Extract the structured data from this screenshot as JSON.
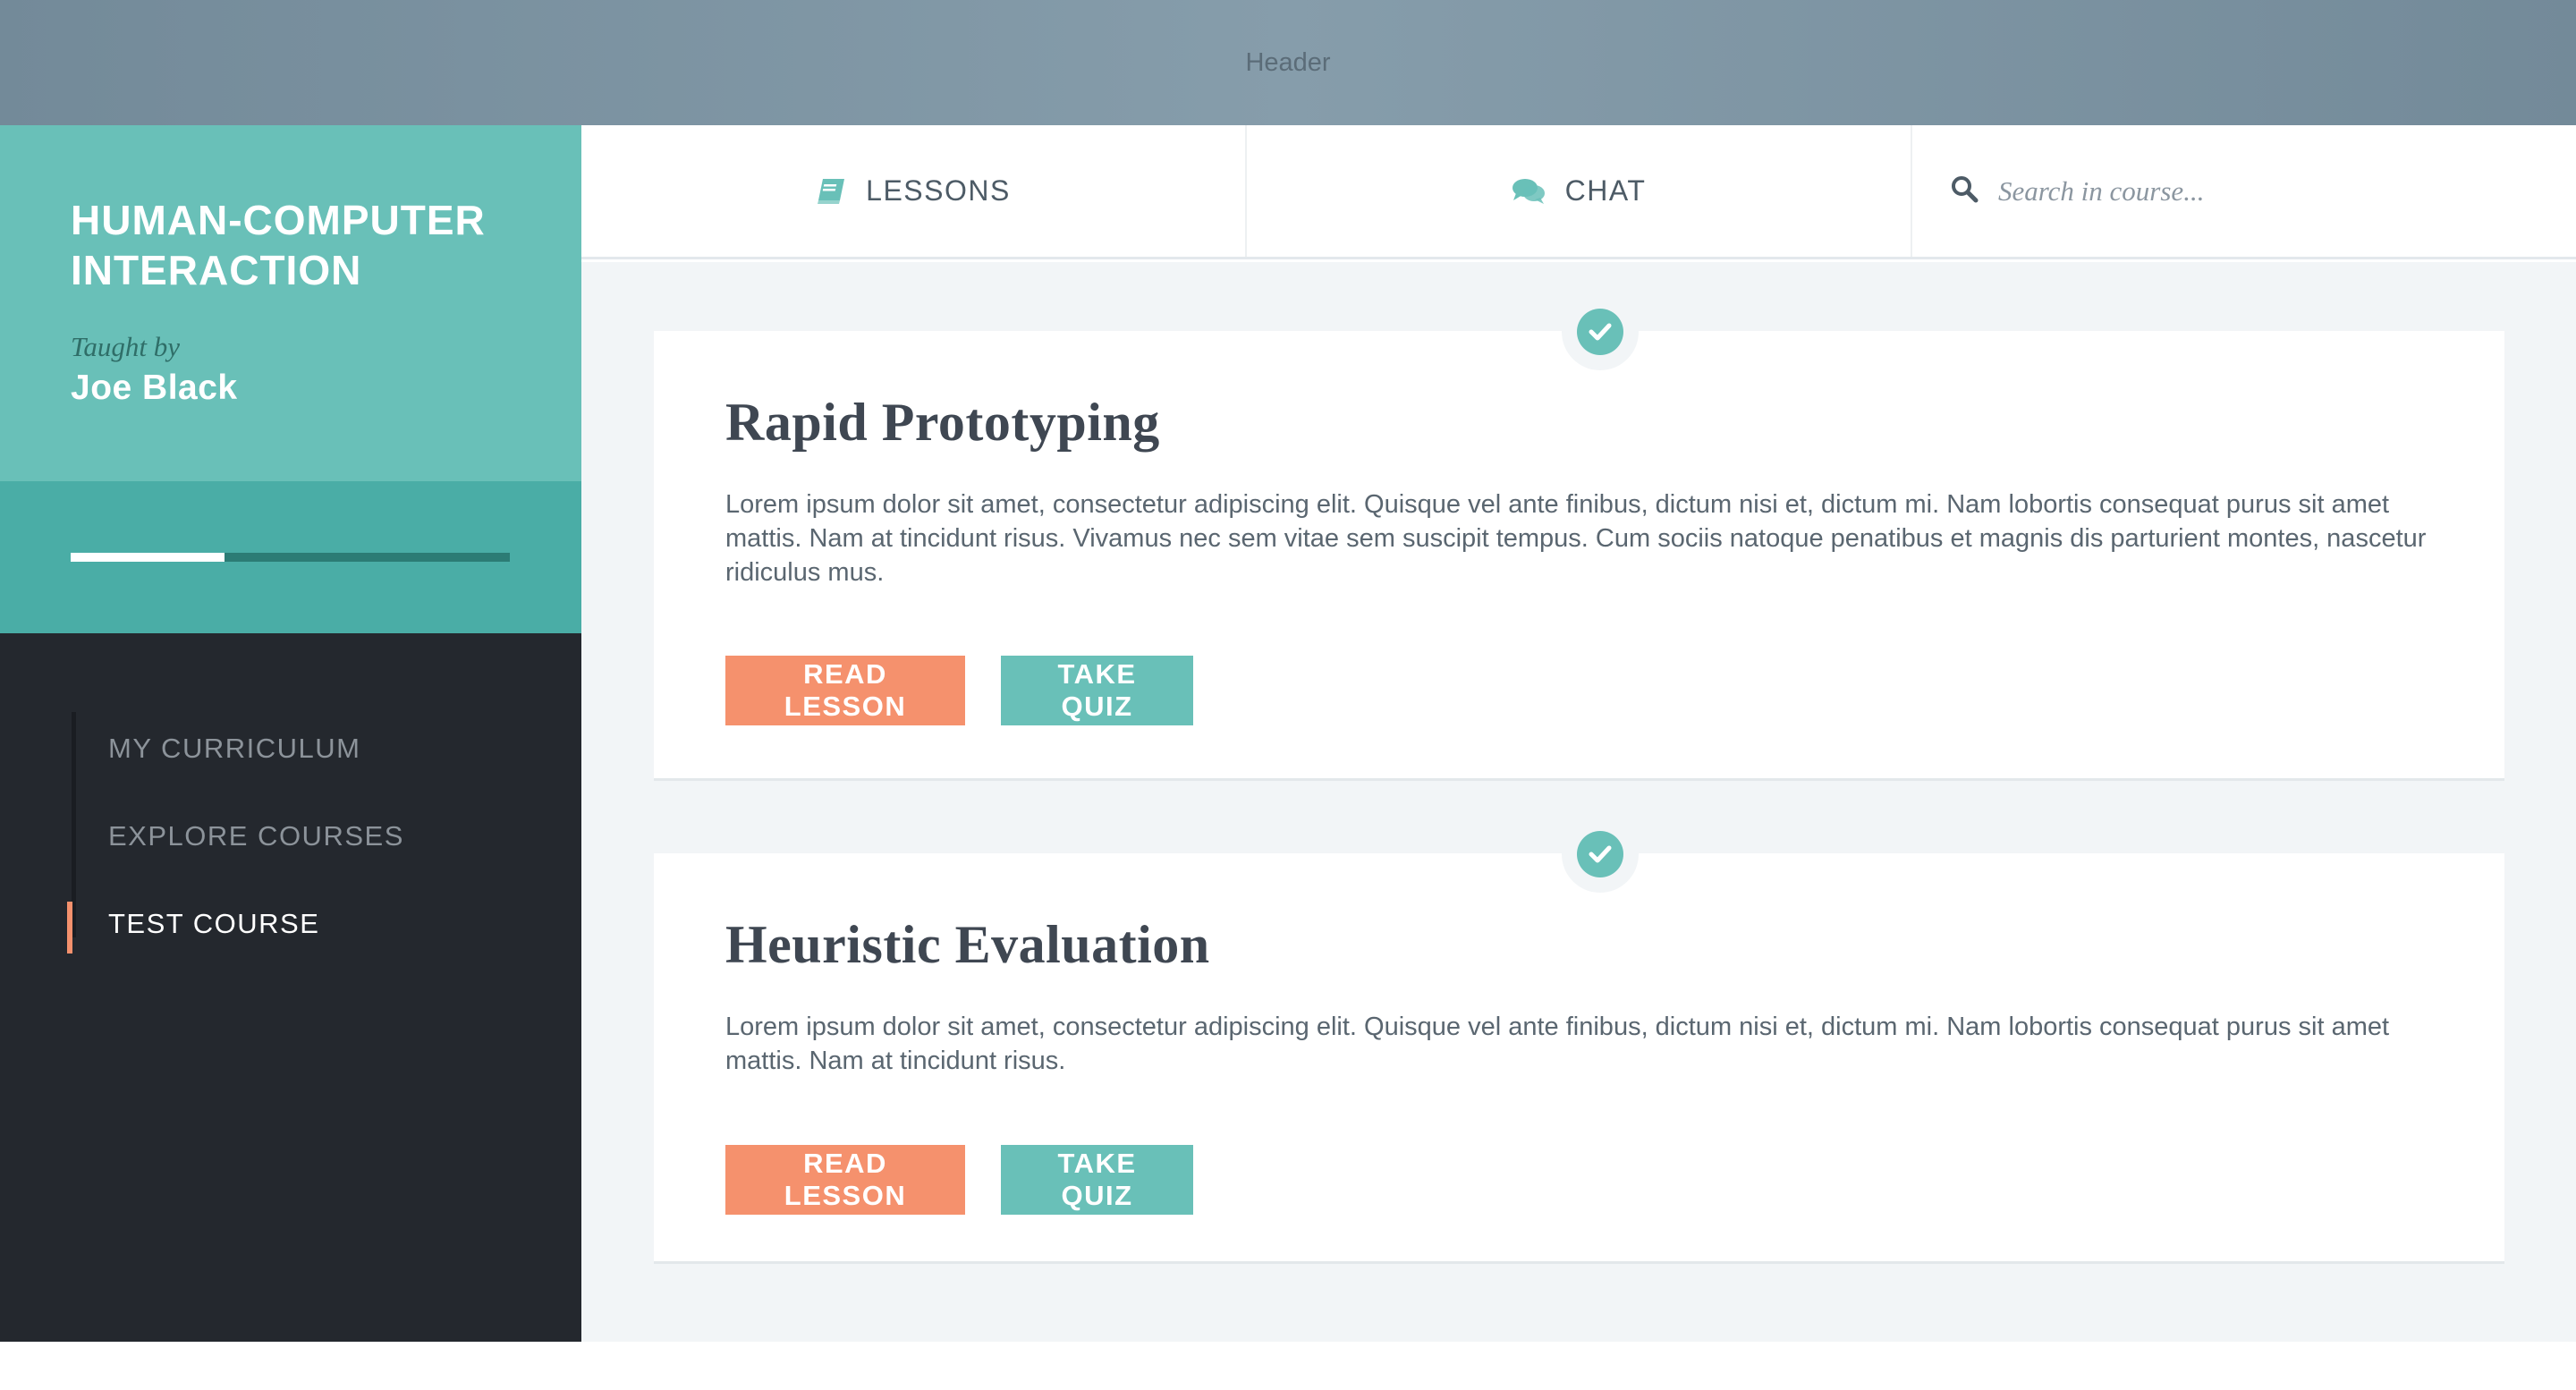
{
  "header": {
    "label": "Header"
  },
  "sidebar": {
    "course_title": "HUMAN-COMPUTER INTERACTION",
    "taught_by_label": "Taught by",
    "teacher_name": "Joe Black",
    "progress": 0.35,
    "nav_items": [
      {
        "label": "MY CURRICULUM",
        "active": false
      },
      {
        "label": "EXPLORE COURSES",
        "active": false
      },
      {
        "label": "TEST COURSE",
        "active": true
      }
    ]
  },
  "tabs": {
    "lessons": {
      "label": "LESSONS",
      "icon": "book-icon"
    },
    "chat": {
      "label": "CHAT",
      "icon": "chat-bubbles-icon"
    },
    "search": {
      "placeholder": "Search in course...",
      "icon": "search-icon"
    }
  },
  "lessons": [
    {
      "title": "Rapid Prototyping",
      "text": "Lorem ipsum dolor sit amet, consectetur adipiscing elit. Quisque vel ante finibus, dictum nisi et, dictum mi. Nam lobortis consequat purus sit amet mattis. Nam at tincidunt risus. Vivamus nec sem vitae sem suscipit tempus. Cum sociis natoque penatibus et magnis dis parturient montes, nascetur ridiculus mus.",
      "read_label": "READ LESSON",
      "quiz_label": "TAKE QUIZ",
      "completed": true
    },
    {
      "title": "Heuristic Evaluation",
      "text": "Lorem ipsum dolor sit amet, consectetur adipiscing elit. Quisque vel ante finibus, dictum nisi et, dictum mi. Nam lobortis consequat purus sit amet mattis. Nam at tincidunt risus.",
      "read_label": "READ LESSON",
      "quiz_label": "TAKE QUIZ",
      "completed": true
    }
  ],
  "colors": {
    "teal": "#69c0b8",
    "teal_dark": "#4aada6",
    "orange": "#f5916d",
    "sidebar_dark": "#24282e",
    "header": "#7f95a3"
  }
}
